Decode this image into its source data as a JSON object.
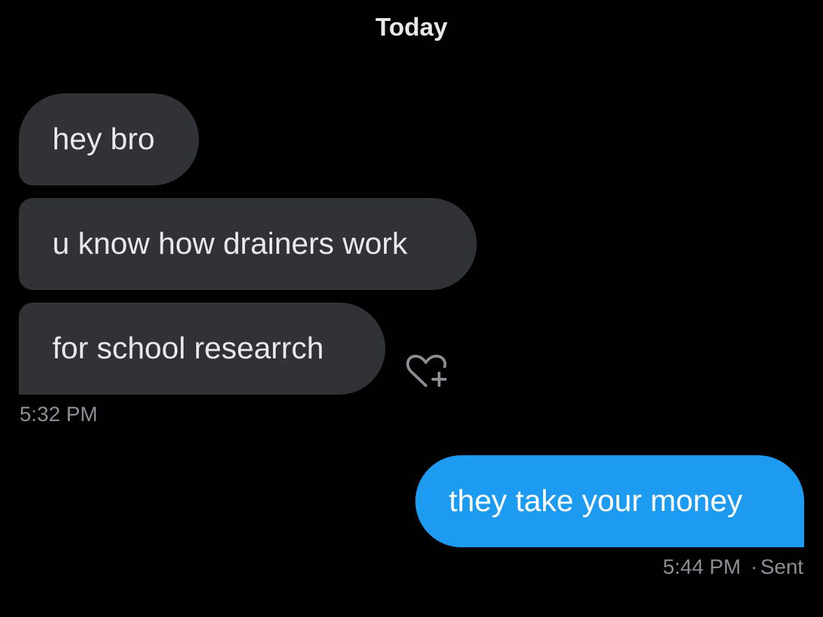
{
  "conversation": {
    "date_header": "Today",
    "incoming": {
      "messages": [
        "hey bro",
        "u know how drainers work",
        "for school researrch"
      ],
      "timestamp": "5:32 PM"
    },
    "outgoing": {
      "message": "they take your money",
      "timestamp": "5:44 PM",
      "separator": "·",
      "status": "Sent"
    }
  },
  "icons": {
    "react": "heart-plus-icon"
  },
  "colors": {
    "background": "#000000",
    "incoming_bubble": "#2f3336",
    "outgoing_bubble": "#1d9bf0",
    "text_primary": "#e7e9ea",
    "text_secondary": "#8b8f93"
  }
}
